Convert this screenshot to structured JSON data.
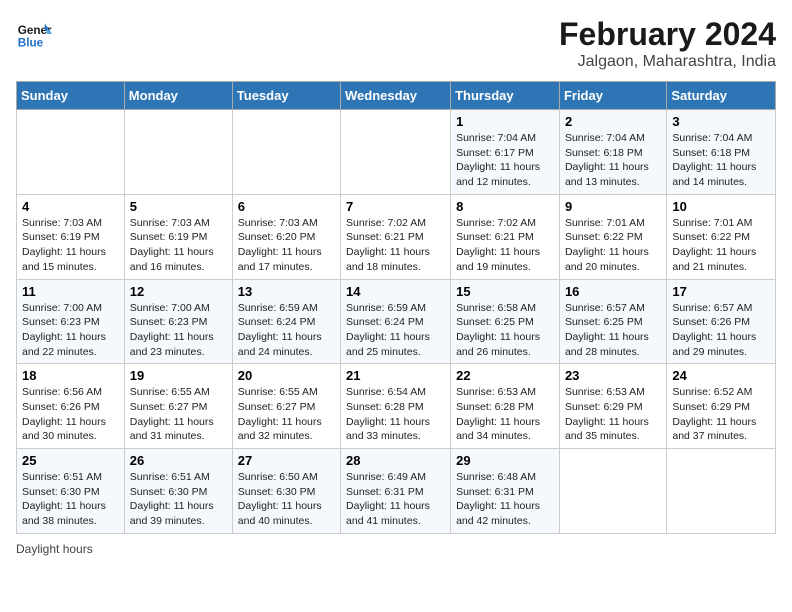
{
  "header": {
    "logo_line1": "General",
    "logo_line2": "Blue",
    "title": "February 2024",
    "subtitle": "Jalgaon, Maharashtra, India"
  },
  "days_of_week": [
    "Sunday",
    "Monday",
    "Tuesday",
    "Wednesday",
    "Thursday",
    "Friday",
    "Saturday"
  ],
  "weeks": [
    [
      {
        "day": "",
        "info": ""
      },
      {
        "day": "",
        "info": ""
      },
      {
        "day": "",
        "info": ""
      },
      {
        "day": "",
        "info": ""
      },
      {
        "day": "1",
        "info": "Sunrise: 7:04 AM\nSunset: 6:17 PM\nDaylight: 11 hours and 12 minutes."
      },
      {
        "day": "2",
        "info": "Sunrise: 7:04 AM\nSunset: 6:18 PM\nDaylight: 11 hours and 13 minutes."
      },
      {
        "day": "3",
        "info": "Sunrise: 7:04 AM\nSunset: 6:18 PM\nDaylight: 11 hours and 14 minutes."
      }
    ],
    [
      {
        "day": "4",
        "info": "Sunrise: 7:03 AM\nSunset: 6:19 PM\nDaylight: 11 hours and 15 minutes."
      },
      {
        "day": "5",
        "info": "Sunrise: 7:03 AM\nSunset: 6:19 PM\nDaylight: 11 hours and 16 minutes."
      },
      {
        "day": "6",
        "info": "Sunrise: 7:03 AM\nSunset: 6:20 PM\nDaylight: 11 hours and 17 minutes."
      },
      {
        "day": "7",
        "info": "Sunrise: 7:02 AM\nSunset: 6:21 PM\nDaylight: 11 hours and 18 minutes."
      },
      {
        "day": "8",
        "info": "Sunrise: 7:02 AM\nSunset: 6:21 PM\nDaylight: 11 hours and 19 minutes."
      },
      {
        "day": "9",
        "info": "Sunrise: 7:01 AM\nSunset: 6:22 PM\nDaylight: 11 hours and 20 minutes."
      },
      {
        "day": "10",
        "info": "Sunrise: 7:01 AM\nSunset: 6:22 PM\nDaylight: 11 hours and 21 minutes."
      }
    ],
    [
      {
        "day": "11",
        "info": "Sunrise: 7:00 AM\nSunset: 6:23 PM\nDaylight: 11 hours and 22 minutes."
      },
      {
        "day": "12",
        "info": "Sunrise: 7:00 AM\nSunset: 6:23 PM\nDaylight: 11 hours and 23 minutes."
      },
      {
        "day": "13",
        "info": "Sunrise: 6:59 AM\nSunset: 6:24 PM\nDaylight: 11 hours and 24 minutes."
      },
      {
        "day": "14",
        "info": "Sunrise: 6:59 AM\nSunset: 6:24 PM\nDaylight: 11 hours and 25 minutes."
      },
      {
        "day": "15",
        "info": "Sunrise: 6:58 AM\nSunset: 6:25 PM\nDaylight: 11 hours and 26 minutes."
      },
      {
        "day": "16",
        "info": "Sunrise: 6:57 AM\nSunset: 6:25 PM\nDaylight: 11 hours and 28 minutes."
      },
      {
        "day": "17",
        "info": "Sunrise: 6:57 AM\nSunset: 6:26 PM\nDaylight: 11 hours and 29 minutes."
      }
    ],
    [
      {
        "day": "18",
        "info": "Sunrise: 6:56 AM\nSunset: 6:26 PM\nDaylight: 11 hours and 30 minutes."
      },
      {
        "day": "19",
        "info": "Sunrise: 6:55 AM\nSunset: 6:27 PM\nDaylight: 11 hours and 31 minutes."
      },
      {
        "day": "20",
        "info": "Sunrise: 6:55 AM\nSunset: 6:27 PM\nDaylight: 11 hours and 32 minutes."
      },
      {
        "day": "21",
        "info": "Sunrise: 6:54 AM\nSunset: 6:28 PM\nDaylight: 11 hours and 33 minutes."
      },
      {
        "day": "22",
        "info": "Sunrise: 6:53 AM\nSunset: 6:28 PM\nDaylight: 11 hours and 34 minutes."
      },
      {
        "day": "23",
        "info": "Sunrise: 6:53 AM\nSunset: 6:29 PM\nDaylight: 11 hours and 35 minutes."
      },
      {
        "day": "24",
        "info": "Sunrise: 6:52 AM\nSunset: 6:29 PM\nDaylight: 11 hours and 37 minutes."
      }
    ],
    [
      {
        "day": "25",
        "info": "Sunrise: 6:51 AM\nSunset: 6:30 PM\nDaylight: 11 hours and 38 minutes."
      },
      {
        "day": "26",
        "info": "Sunrise: 6:51 AM\nSunset: 6:30 PM\nDaylight: 11 hours and 39 minutes."
      },
      {
        "day": "27",
        "info": "Sunrise: 6:50 AM\nSunset: 6:30 PM\nDaylight: 11 hours and 40 minutes."
      },
      {
        "day": "28",
        "info": "Sunrise: 6:49 AM\nSunset: 6:31 PM\nDaylight: 11 hours and 41 minutes."
      },
      {
        "day": "29",
        "info": "Sunrise: 6:48 AM\nSunset: 6:31 PM\nDaylight: 11 hours and 42 minutes."
      },
      {
        "day": "",
        "info": ""
      },
      {
        "day": "",
        "info": ""
      }
    ]
  ],
  "footer": {
    "daylight_label": "Daylight hours"
  }
}
